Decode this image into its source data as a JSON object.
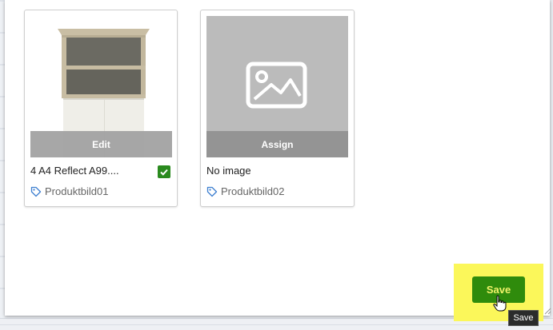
{
  "cards": [
    {
      "overlay_label": "Edit",
      "title": "4 A4 Reflect A99....",
      "tag": "Produktbild01",
      "has_image": true,
      "checked": true
    },
    {
      "overlay_label": "Assign",
      "title": "No image",
      "tag": "Produktbild02",
      "has_image": false,
      "checked": false
    }
  ],
  "save_button": {
    "label": "Save",
    "color": "#2f8b0c"
  },
  "tooltip": {
    "text": "Save"
  },
  "colors": {
    "highlight": "#fbf75a",
    "checkbox": "#2a8a1e",
    "tag_icon": "#3d7fd0",
    "placeholder": "#bbbbbb"
  }
}
